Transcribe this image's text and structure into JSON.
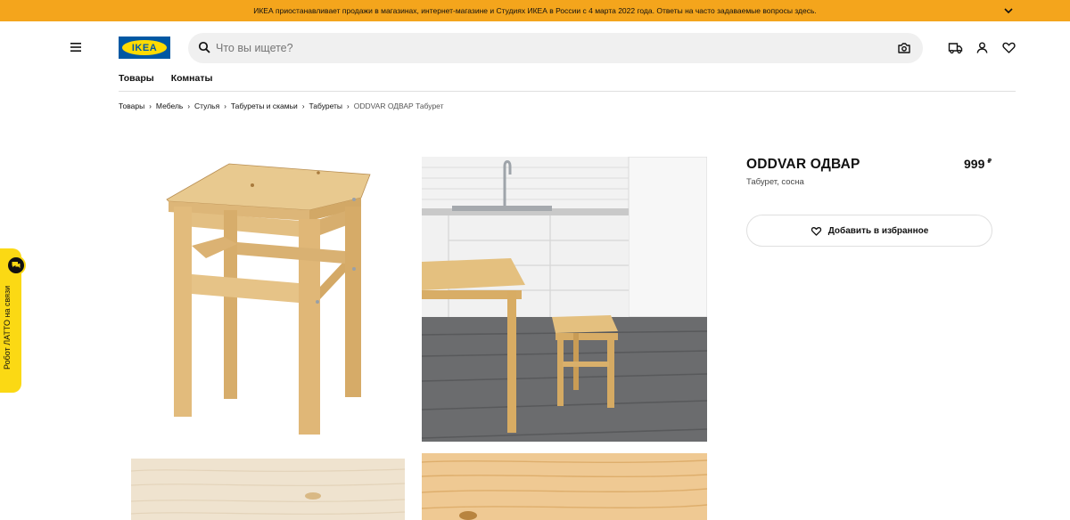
{
  "banner": {
    "text": "ИКЕА приостанавливает продажи в магазинах, интернет-магазине и Студиях ИКЕА в России с 4 марта 2022 года. Ответы на часто задаваемые вопросы здесь."
  },
  "header": {
    "logo_text": "IKEA",
    "search_placeholder": "Что вы ищете?",
    "nav": [
      "Товары",
      "Комнаты"
    ]
  },
  "breadcrumb": {
    "items": [
      "Товары",
      "Мебель",
      "Стулья",
      "Табуреты и скамьи",
      "Табуреты"
    ],
    "current": "ODDVAR ОДВАР Табурет"
  },
  "product": {
    "name": "ODDVAR ОДВАР",
    "description": "Табурет, сосна",
    "price": "999",
    "currency": "₽",
    "favorite_label": "Добавить в избранное"
  },
  "chat": {
    "label": "Робот ЛАТТО на связи"
  },
  "colors": {
    "banner": "#f4a51c",
    "brand_blue": "#0058a3",
    "brand_yellow": "#ffdb00",
    "chat_yellow": "#fbd914"
  }
}
